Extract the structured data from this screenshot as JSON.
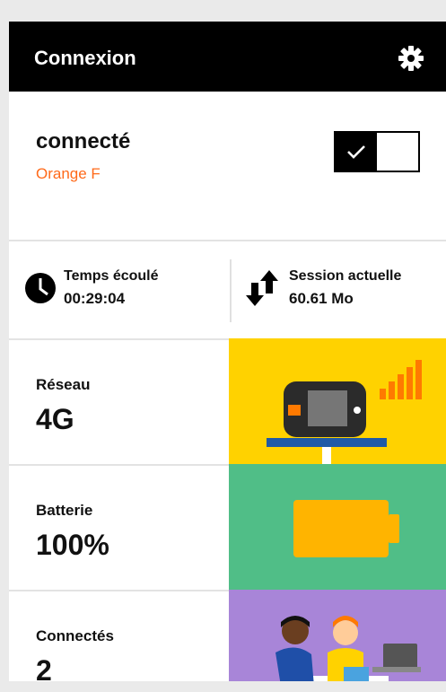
{
  "header": {
    "title": "Connexion",
    "settings_icon": "gear-icon"
  },
  "connection": {
    "status": "connecté",
    "operator": "Orange F",
    "toggle_on": true,
    "operator_color": "#ff6a1a"
  },
  "stats": {
    "time": {
      "label": "Temps écoulé",
      "value": "00:29:04",
      "icon": "clock-icon"
    },
    "session": {
      "label": "Session actuelle",
      "value": "60.61 Mo",
      "icon": "transfer-arrows-icon"
    }
  },
  "tiles": [
    {
      "label": "Réseau",
      "value": "4G",
      "color": "#ffd200",
      "illustration": "router-signal"
    },
    {
      "label": "Batterie",
      "value": "100%",
      "color": "#50be87",
      "illustration": "battery"
    },
    {
      "label": "Connectés",
      "value": "2",
      "color": "#a885d8",
      "illustration": "people-at-laptop"
    }
  ]
}
